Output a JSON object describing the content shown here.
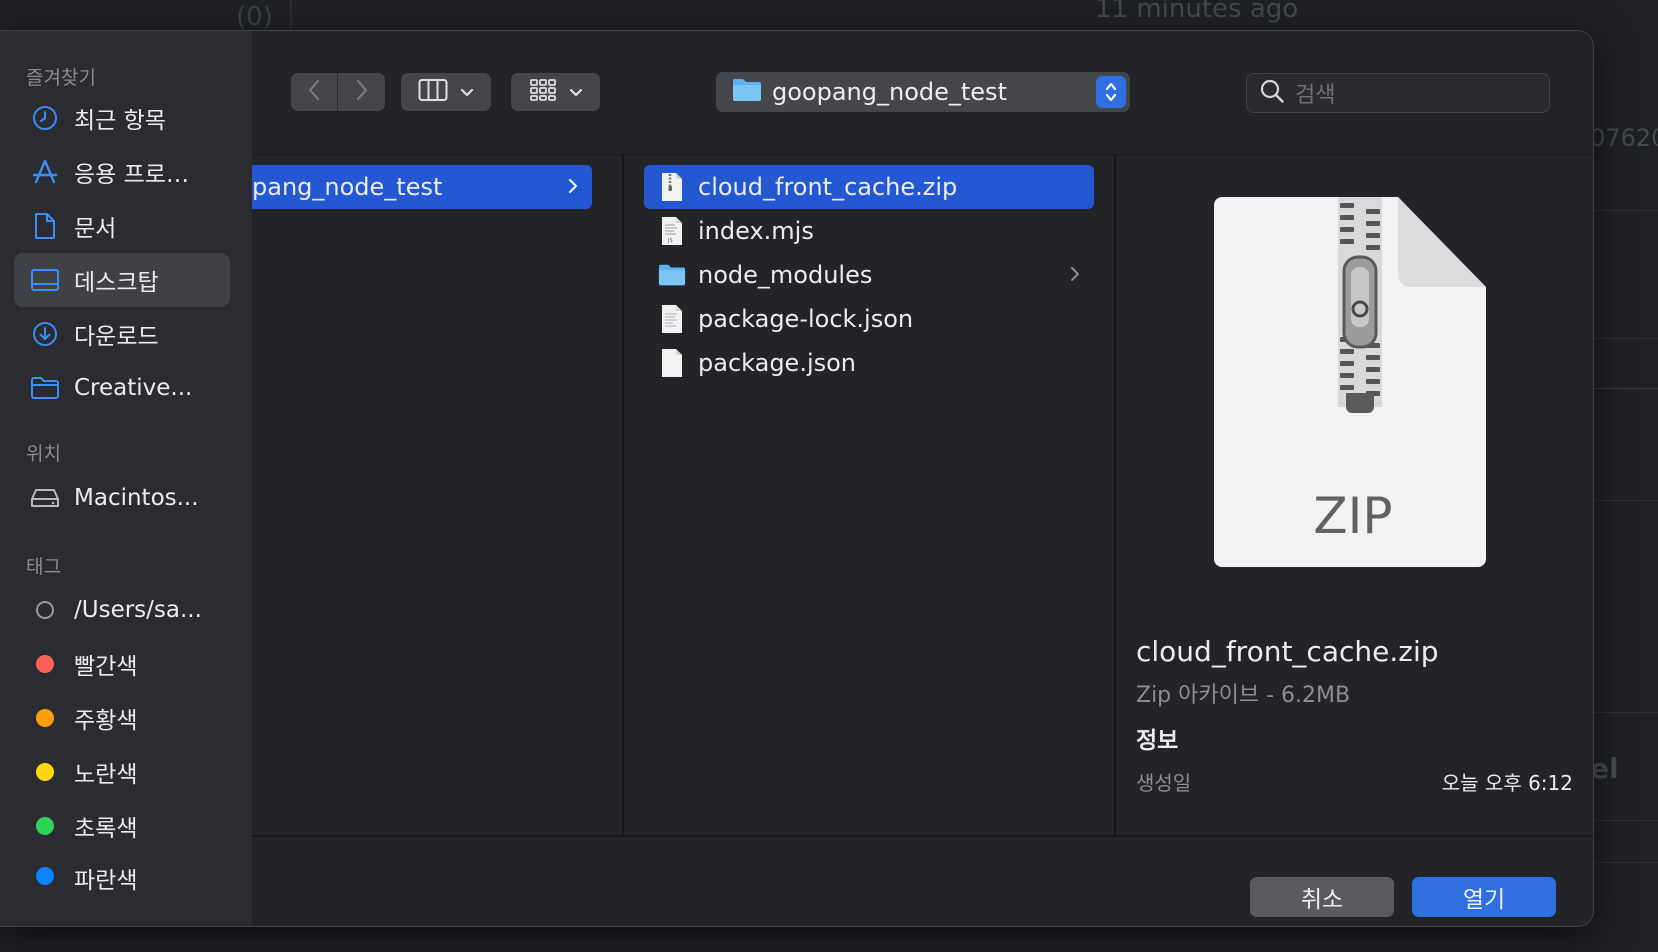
{
  "background": {
    "count_text": "(0)",
    "time_text": "11 minutes ago",
    "side_text": "07620",
    "side_text2": "el"
  },
  "sidebar": {
    "favorites_header": "즐겨찾기",
    "favorites": [
      {
        "label": "최근 항목",
        "icon": "clock-icon"
      },
      {
        "label": "응용 프로…",
        "icon": "applications-icon"
      },
      {
        "label": "문서",
        "icon": "document-icon"
      },
      {
        "label": "데스크탑",
        "icon": "desktop-icon"
      },
      {
        "label": "다운로드",
        "icon": "download-icon"
      },
      {
        "label": "Creative...",
        "icon": "folder-icon"
      }
    ],
    "locations_header": "위치",
    "locations": [
      {
        "label": "Macintos...",
        "icon": "hard-drive-icon"
      }
    ],
    "tags_header": "태그",
    "tags": [
      {
        "label": "/Users/sa...",
        "color": "none"
      },
      {
        "label": "빨간색",
        "color": "#ff5f57"
      },
      {
        "label": "주황색",
        "color": "#ff9f0a"
      },
      {
        "label": "노란색",
        "color": "#ffd60a"
      },
      {
        "label": "초록색",
        "color": "#30d158"
      },
      {
        "label": "파란색",
        "color": "#0a84ff"
      }
    ]
  },
  "toolbar": {
    "path_label": "goopang_node_test",
    "search_placeholder": "검색"
  },
  "columns": {
    "col1": [
      {
        "label": "pang_node_test",
        "selected": true,
        "has_children": true
      }
    ],
    "col2": [
      {
        "label": "cloud_front_cache.zip",
        "icon": "zip-file-icon",
        "selected": true
      },
      {
        "label": "index.mjs",
        "icon": "js-file-icon"
      },
      {
        "label": "node_modules",
        "icon": "folder-icon",
        "has_children": true
      },
      {
        "label": "package-lock.json",
        "icon": "json-file-icon"
      },
      {
        "label": "package.json",
        "icon": "blank-file-icon"
      }
    ]
  },
  "preview": {
    "file_name": "cloud_front_cache.zip",
    "kind": "Zip 아카이브 - 6.2MB",
    "info_header": "정보",
    "created_label": "생성일",
    "created_value": "오늘 오후 6:12",
    "thumbnail_label": "ZIP"
  },
  "buttons": {
    "cancel": "취소",
    "open": "열기"
  },
  "colors": {
    "accent": "#2f6fe0",
    "selection": "#2458d2"
  }
}
